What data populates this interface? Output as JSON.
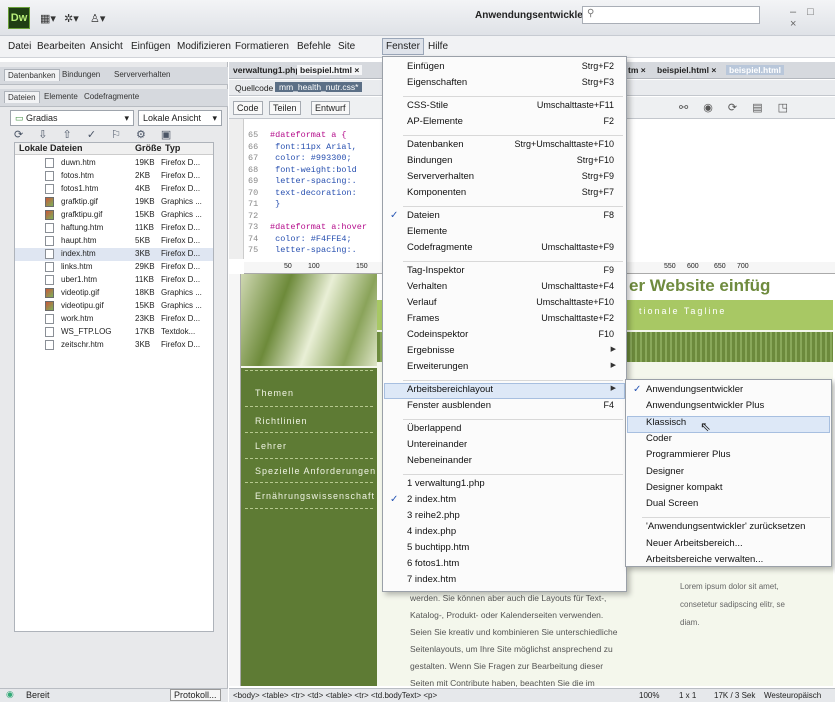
{
  "titlebar": {
    "logo": "Dw",
    "workspace": "Anwendungsentwickler",
    "window_controls": "– □ ×"
  },
  "menubar": [
    "Datei",
    "Bearbeiten",
    "Ansicht",
    "Einfügen",
    "Modifizieren",
    "Formatieren",
    "Befehle",
    "Site",
    "Fenster",
    "Hilfe"
  ],
  "left_panel": {
    "tabs_top": [
      "Datenbanken",
      "Bindungen",
      "Serververhalten"
    ],
    "tabs_files": [
      "Dateien",
      "Elemente",
      "Codefragmente"
    ],
    "site_select": "Gradias",
    "view_select": "Lokale Ansicht",
    "columns": [
      "Lokale Dateien",
      "Größe",
      "Typ"
    ],
    "files": [
      {
        "name": "duwn.htm",
        "size": "19KB",
        "type": "Firefox D..."
      },
      {
        "name": "fotos.htm",
        "size": "2KB",
        "type": "Firefox D..."
      },
      {
        "name": "fotos1.htm",
        "size": "4KB",
        "type": "Firefox D..."
      },
      {
        "name": "grafktip.gif",
        "size": "19KB",
        "type": "Graphics ..."
      },
      {
        "name": "grafktipu.gif",
        "size": "15KB",
        "type": "Graphics ..."
      },
      {
        "name": "haftung.htm",
        "size": "11KB",
        "type": "Firefox D..."
      },
      {
        "name": "haupt.htm",
        "size": "5KB",
        "type": "Firefox D..."
      },
      {
        "name": "index.htm",
        "size": "3KB",
        "type": "Firefox D..."
      },
      {
        "name": "links.htm",
        "size": "29KB",
        "type": "Firefox D..."
      },
      {
        "name": "uber1.htm",
        "size": "11KB",
        "type": "Firefox D..."
      },
      {
        "name": "videotip.gif",
        "size": "18KB",
        "type": "Graphics ..."
      },
      {
        "name": "videotipu.gif",
        "size": "15KB",
        "type": "Graphics ..."
      },
      {
        "name": "work.htm",
        "size": "23KB",
        "type": "Firefox D..."
      },
      {
        "name": "WS_FTP.LOG",
        "size": "17KB",
        "type": "Textdok..."
      },
      {
        "name": "zeitschr.htm",
        "size": "3KB",
        "type": "Firefox D..."
      }
    ],
    "status": "Bereit",
    "protocol_button": "Protokoll..."
  },
  "editor": {
    "tabs": [
      "verwaltung1.php ×",
      "beispiel.html ×"
    ],
    "right_tabs": [
      "tm ×",
      "beispiel.html ×",
      "beispiel.html"
    ],
    "source_label": "Quellcode",
    "related_file": "mm_health_nutr.css*",
    "view_buttons": [
      "Code",
      "Teilen",
      "Entwurf"
    ],
    "code_lines": [
      {
        "n": "65",
        "text": "#dateformat a {",
        "cls": "c-sel"
      },
      {
        "n": "66",
        "text": "    font:11px Arial,",
        "cls": "c-prop"
      },
      {
        "n": "67",
        "text": "    color: #993300;",
        "cls": "c-prop"
      },
      {
        "n": "68",
        "text": "    font-weight:bold",
        "cls": "c-prop"
      },
      {
        "n": "69",
        "text": "    letter-spacing:.",
        "cls": "c-prop"
      },
      {
        "n": "70",
        "text": "    text-decoration:",
        "cls": "c-prop"
      },
      {
        "n": "71",
        "text": "    }",
        "cls": "c-prop"
      },
      {
        "n": "72",
        "text": "",
        "cls": ""
      },
      {
        "n": "73",
        "text": "#dateformat a:hover",
        "cls": "c-sel"
      },
      {
        "n": "74",
        "text": "    color: #F4FFE4;",
        "cls": "c-prop"
      },
      {
        "n": "75",
        "text": "    letter-spacing:.",
        "cls": "c-prop"
      }
    ],
    "ruler": [
      "50",
      "100",
      "150",
      "550",
      "600",
      "650",
      "700"
    ],
    "heading_fragment": "er Website einfüg",
    "tagline_fragment": "tionale Tagline",
    "nav": [
      "Themen",
      "Richtlinien",
      "Lehrer",
      "Spezielle Anforderungen",
      "Ernährungswissenschaft"
    ],
    "body_lines": [
      "werden. Sie können aber auch die Layouts für Text-,",
      "Katalog-, Produkt- oder Kalenderseiten verwenden.",
      "Seien Sie kreativ und kombinieren Sie unterschiedliche",
      "Seitenlayouts, um Ihre Site möglichst ansprechend zu",
      "gestalten. Wenn Sie Fragen zur Bearbeitung dieser",
      "Seiten mit Contribute haben, beachten Sie die im"
    ],
    "side_lines": [
      "Lorem ipsum dolor sit amet,",
      "consetetur sadipscing elitr, se",
      "diam."
    ],
    "tag_path": "<body> <table> <tr> <td> <table> <tr> <td.bodyText> <p>",
    "zoom": "100%",
    "dims": "1 x 1",
    "weight": "17K / 3 Sek",
    "encoding": "Westeuropäisch"
  },
  "fenster_menu": {
    "items": [
      {
        "label": "Einfügen",
        "shortcut": "Strg+F2"
      },
      {
        "label": "Eigenschaften",
        "shortcut": "Strg+F3"
      },
      {
        "sep": true
      },
      {
        "label": "CSS-Stile",
        "shortcut": "Umschalttaste+F11"
      },
      {
        "label": "AP-Elemente",
        "shortcut": "F2"
      },
      {
        "sep": true
      },
      {
        "label": "Datenbanken",
        "shortcut": "Strg+Umschalttaste+F10"
      },
      {
        "label": "Bindungen",
        "shortcut": "Strg+F10"
      },
      {
        "label": "Serververhalten",
        "shortcut": "Strg+F9"
      },
      {
        "label": "Komponenten",
        "shortcut": "Strg+F7"
      },
      {
        "sep": true
      },
      {
        "label": "Dateien",
        "shortcut": "F8",
        "checked": true
      },
      {
        "label": "Elemente",
        "shortcut": ""
      },
      {
        "label": "Codefragmente",
        "shortcut": "Umschalttaste+F9"
      },
      {
        "sep": true
      },
      {
        "label": "Tag-Inspektor",
        "shortcut": "F9"
      },
      {
        "label": "Verhalten",
        "shortcut": "Umschalttaste+F4"
      },
      {
        "label": "Verlauf",
        "shortcut": "Umschalttaste+F10"
      },
      {
        "label": "Frames",
        "shortcut": "Umschalttaste+F2"
      },
      {
        "label": "Codeinspektor",
        "shortcut": "F10"
      },
      {
        "label": "Ergebnisse",
        "shortcut": "",
        "submenu": true
      },
      {
        "label": "Erweiterungen",
        "shortcut": "",
        "submenu": true
      },
      {
        "sep": true
      },
      {
        "label": "Arbeitsbereichlayout",
        "shortcut": "",
        "submenu": true,
        "highlighted": true
      },
      {
        "label": "Fenster ausblenden",
        "shortcut": "F4"
      },
      {
        "sep": true
      },
      {
        "label": "Überlappend",
        "shortcut": ""
      },
      {
        "label": "Untereinander",
        "shortcut": ""
      },
      {
        "label": "Nebeneinander",
        "shortcut": ""
      },
      {
        "sep": true
      },
      {
        "label": "1 verwaltung1.php",
        "shortcut": ""
      },
      {
        "label": "2 index.htm",
        "shortcut": "",
        "checked": true
      },
      {
        "label": "3 reihe2.php",
        "shortcut": ""
      },
      {
        "label": "4 index.php",
        "shortcut": ""
      },
      {
        "label": "5 buchtipp.htm",
        "shortcut": ""
      },
      {
        "label": "6 fotos1.htm",
        "shortcut": ""
      },
      {
        "label": "7 index.htm",
        "shortcut": ""
      }
    ]
  },
  "submenu": {
    "items": [
      {
        "label": "Anwendungsentwickler",
        "checked": true
      },
      {
        "label": "Anwendungsentwickler Plus"
      },
      {
        "label": "Klassisch",
        "highlighted": true
      },
      {
        "label": "Coder"
      },
      {
        "label": "Programmierer Plus"
      },
      {
        "label": "Designer"
      },
      {
        "label": "Designer kompakt"
      },
      {
        "label": "Dual Screen"
      },
      {
        "sep": true
      },
      {
        "label": "'Anwendungsentwickler' zurücksetzen"
      },
      {
        "label": "Neuer Arbeitsbereich..."
      },
      {
        "label": "Arbeitsbereiche verwalten..."
      }
    ]
  }
}
